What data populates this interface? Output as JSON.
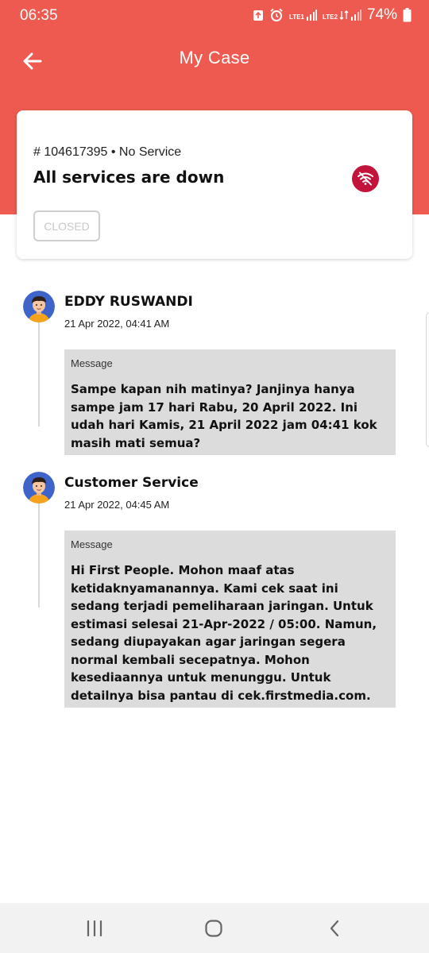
{
  "status_bar": {
    "time": "06:35",
    "battery": "74%",
    "sim1": "LTE1",
    "sim2": "LTE2"
  },
  "app_bar": {
    "title": "My Case",
    "back_icon": "arrow-left-icon"
  },
  "case": {
    "meta": "# 104617395 • No Service",
    "title": "All services are down",
    "status_icon": "wifi-off-icon",
    "status_label": "CLOSED"
  },
  "messages": [
    {
      "author": "EDDY RUSWANDI",
      "timestamp": "21 Apr 2022, 04:41 AM",
      "label": "Message",
      "text": "Sampe kapan nih matinya? Janjinya hanya sampe jam 17 hari Rabu, 20 April 2022. Ini udah hari Kamis, 21 April 2022 jam 04:41 kok masih mati semua?"
    },
    {
      "author": "Customer Service",
      "timestamp": "21 Apr 2022, 04:45 AM",
      "label": "Message",
      "text": "Hi First People. Mohon maaf atas ketidaknyamanannya. Kami cek saat ini sedang terjadi pemeliharaan jaringan. Untuk estimasi selesai 21-Apr-2022 / 05:00. Namun, sedang diupayakan agar jaringan segera normal kembali secepatnya. Mohon kesediaannya untuk menunggu. Untuk detailnya bisa pantau di cek.firstmedia.com."
    }
  ],
  "colors": {
    "header": "#ee5a50",
    "status_icon_bg": "#c3133a",
    "message_bg": "#dcdcdc"
  },
  "nav": {
    "recent_icon": "recent-apps-icon",
    "home_icon": "home-icon",
    "back_icon": "back-icon"
  }
}
